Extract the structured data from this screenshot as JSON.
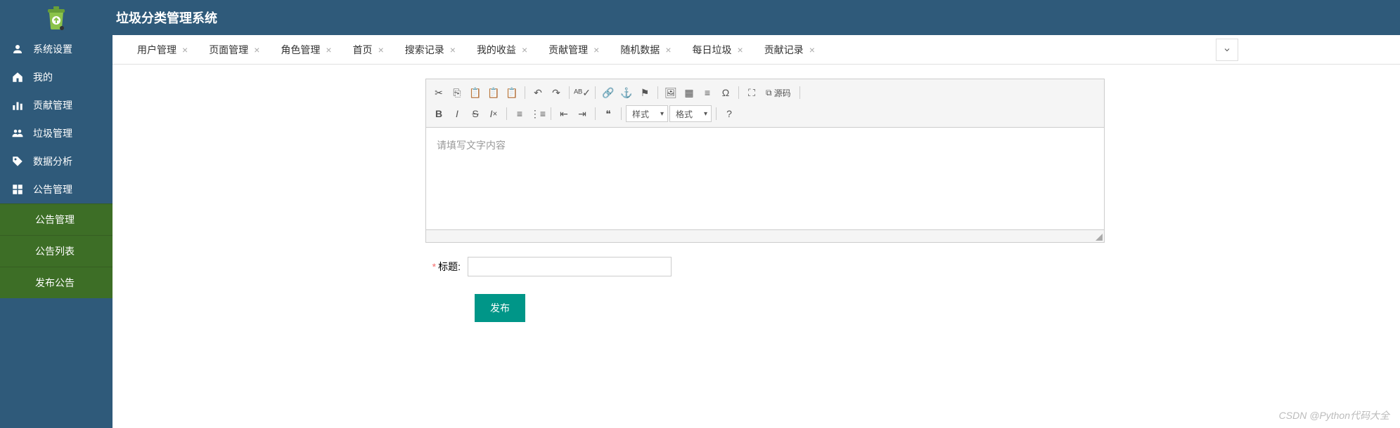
{
  "header": {
    "title": "垃圾分类管理系统"
  },
  "sidebar": {
    "items": [
      {
        "label": "系统设置",
        "icon": "user"
      },
      {
        "label": "我的",
        "icon": "home"
      },
      {
        "label": "贡献管理",
        "icon": "bar"
      },
      {
        "label": "垃圾管理",
        "icon": "users"
      },
      {
        "label": "数据分析",
        "icon": "tag"
      },
      {
        "label": "公告管理",
        "icon": "grid"
      }
    ],
    "sub_items": [
      {
        "label": "公告管理"
      },
      {
        "label": "公告列表"
      },
      {
        "label": "发布公告"
      }
    ]
  },
  "tabs": [
    {
      "label": "用户管理"
    },
    {
      "label": "页面管理"
    },
    {
      "label": "角色管理"
    },
    {
      "label": "首页"
    },
    {
      "label": "搜索记录"
    },
    {
      "label": "我的收益"
    },
    {
      "label": "贡献管理"
    },
    {
      "label": "随机数据"
    },
    {
      "label": "每日垃圾"
    },
    {
      "label": "贡献记录"
    }
  ],
  "editor": {
    "placeholder": "请填写文字内容",
    "style_select": "样式",
    "format_select": "格式",
    "source_label": "源码"
  },
  "form": {
    "title_label": "标题:",
    "title_value": "",
    "submit_label": "发布"
  },
  "watermark": "CSDN @Python代码大全"
}
